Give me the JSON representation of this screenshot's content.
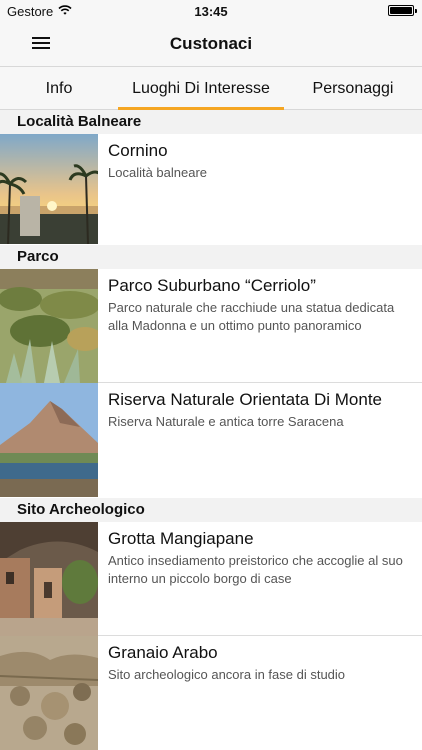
{
  "status": {
    "carrier": "Gestore",
    "time": "13:45"
  },
  "nav": {
    "title": "Custonaci"
  },
  "tabs": [
    {
      "label": "Info",
      "active": false
    },
    {
      "label": "Luoghi Di Interesse",
      "active": true
    },
    {
      "label": "Personaggi",
      "active": false
    }
  ],
  "accent_color": "#f5a623",
  "sections": [
    {
      "header": "Località Balneare",
      "items": [
        {
          "title": "Cornino",
          "subtitle": "Località balneare",
          "image": "beach-sunset-photo"
        }
      ]
    },
    {
      "header": "Parco",
      "items": [
        {
          "title": "Parco Suburbano “Cerriolo”",
          "subtitle": "Parco naturale che racchiude una statua dedicata alla Madonna e un ottimo punto panoramico",
          "image": "park-vegetation-photo"
        },
        {
          "title": "Riserva Naturale Orientata Di Monte",
          "subtitle": "Riserva Naturale e antica torre Saracena",
          "image": "mountain-coast-photo"
        }
      ]
    },
    {
      "header": "Sito Archeologico",
      "items": [
        {
          "title": "Grotta Mangiapane",
          "subtitle": "Antico insediamento preistorico che accoglie al suo interno un piccolo borgo di case",
          "image": "cave-village-photo"
        },
        {
          "title": "Granaio Arabo",
          "subtitle": "Sito archeologico ancora in fase di studio",
          "image": "stone-ruins-photo"
        }
      ]
    }
  ]
}
